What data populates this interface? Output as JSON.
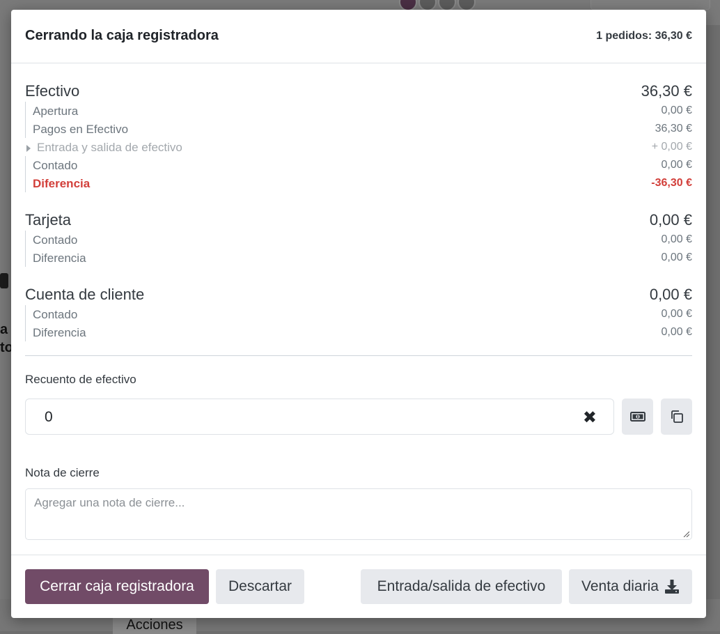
{
  "background": {
    "left_text_lines": [
      "a",
      "to"
    ],
    "actions_label": "Acciones"
  },
  "header": {
    "title": "Cerrando la caja registradora",
    "summary": "1 pedidos: 36,30 €"
  },
  "sections": [
    {
      "name": "Efectivo",
      "amount": "36,30 €",
      "rows": [
        {
          "label": "Apertura",
          "value": "0,00 €"
        },
        {
          "label": "Pagos en Efectivo",
          "value": "36,30 €"
        },
        {
          "label": "Entrada y salida de efectivo",
          "value": "+ 0,00 €"
        },
        {
          "label": "Contado",
          "value": "0,00 €"
        },
        {
          "label": "Diferencia",
          "value": "-36,30 €"
        }
      ]
    },
    {
      "name": "Tarjeta",
      "amount": "0,00 €",
      "rows": [
        {
          "label": "Contado",
          "value": "0,00 €"
        },
        {
          "label": "Diferencia",
          "value": "0,00 €"
        }
      ]
    },
    {
      "name": "Cuenta de cliente",
      "amount": "0,00 €",
      "rows": [
        {
          "label": "Contado",
          "value": "0,00 €"
        },
        {
          "label": "Diferencia",
          "value": "0,00 €"
        }
      ]
    }
  ],
  "cash_count": {
    "label": "Recuento de efectivo",
    "value": "0",
    "clear_icon": "close-icon",
    "money_button_icon": "money-icon",
    "copy_button_icon": "copy-icon"
  },
  "closing_note": {
    "label": "Nota de cierre",
    "placeholder": "Agregar una nota de cierre..."
  },
  "footer": {
    "close_register": "Cerrar caja registradora",
    "discard": "Descartar",
    "cash_in_out": "Entrada/salida de efectivo",
    "daily_sale": "Venta diaria",
    "daily_sale_icon": "download-icon"
  },
  "colors": {
    "primary": "#714b67",
    "danger": "#d23f3a",
    "muted_text": "#6c757d",
    "button_bg": "#e7e9ed"
  }
}
